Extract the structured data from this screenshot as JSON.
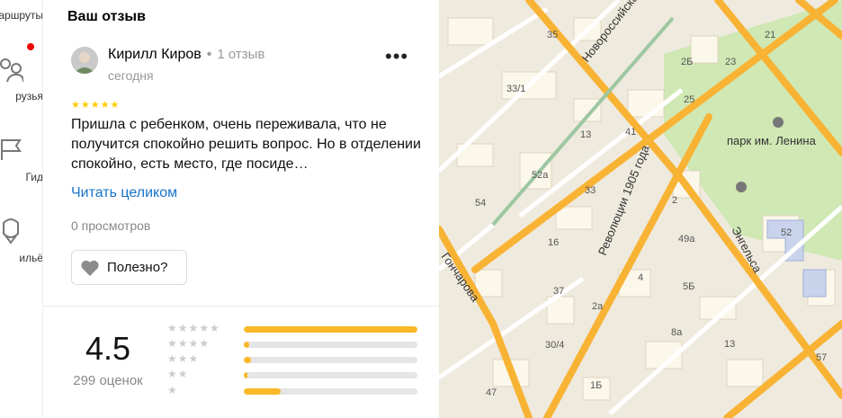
{
  "sidebar": {
    "items": [
      {
        "label": "аршруты",
        "icon": "route-icon"
      },
      {
        "label": "рузья",
        "icon": "friends-icon",
        "has_notification": true
      },
      {
        "label": "Гид",
        "icon": "guide-flag-icon"
      },
      {
        "label": "ильё",
        "icon": "housing-icon"
      }
    ]
  },
  "review_panel": {
    "title": "Ваш отзыв",
    "author": {
      "name": "Кирилл Киров",
      "separator": "•",
      "reviews_count": "1 отзыв",
      "date": "сегодня"
    },
    "rating_stars": "★★★★★",
    "text": "Пришла с ребенком, очень переживала, что не получится спокойно решить вопрос. Но в отделении спокойно, есть место, где посиде…",
    "read_more": "Читать целиком",
    "views": "0 просмотров",
    "useful_label": "Полезно?",
    "more_menu": "•••"
  },
  "rating_summary": {
    "value": "4.5",
    "count": "299 оценок",
    "distribution": [
      {
        "stars": "★★★★★",
        "fraction": 1.0
      },
      {
        "stars": "★★★★",
        "fraction": 0.03
      },
      {
        "stars": "★★★",
        "fraction": 0.04
      },
      {
        "stars": "★★",
        "fraction": 0.02
      },
      {
        "stars": "★",
        "fraction": 0.21
      }
    ]
  },
  "map": {
    "street_labels": [
      "Новороссийская",
      "Революции 1905 года",
      "Энгельса",
      "Гончарова"
    ],
    "park_label": "парк им. Ленина",
    "house_numbers": [
      "35",
      "33/1",
      "41",
      "25",
      "2Б",
      "23",
      "21",
      "13",
      "52а",
      "33",
      "54",
      "16",
      "2",
      "49а",
      "52",
      "4",
      "5Б",
      "37",
      "2а",
      "30/4",
      "8а",
      "13",
      "57",
      "47",
      "1Б"
    ]
  },
  "colors": {
    "accent_link": "#1a73c8",
    "star_yellow": "#fbb829",
    "notification": "#ee0000",
    "road": "#f8b334",
    "park": "#cfe8b4"
  }
}
